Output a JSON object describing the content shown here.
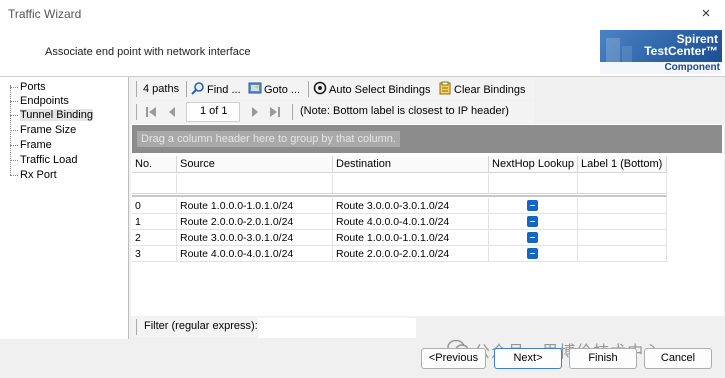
{
  "window": {
    "title": "Traffic Wizard",
    "close_glyph": "×"
  },
  "header": {
    "subtitle": "Associate end point with network interface",
    "logo": {
      "line1": "Spirent",
      "line2": "TestCenter™",
      "badge": "Component",
      "color": "#2c63a6"
    }
  },
  "nav": {
    "items": [
      {
        "label": "Ports"
      },
      {
        "label": "Endpoints"
      },
      {
        "label": "Tunnel Binding",
        "selected": true
      },
      {
        "label": "Frame Size"
      },
      {
        "label": "Frame"
      },
      {
        "label": "Traffic Load"
      },
      {
        "label": "Rx Port"
      }
    ]
  },
  "toolbar": {
    "paths_label": "4 paths",
    "find_label": "Find ...",
    "goto_label": "Goto ...",
    "auto_select_label": "Auto Select Bindings",
    "clear_label": "Clear Bindings"
  },
  "pager": {
    "page_text": "1 of 1",
    "note": "(Note: Bottom label is closest to IP header)"
  },
  "grid": {
    "group_hint": "Drag a column header here to group by that column.",
    "columns": [
      "No.",
      "Source",
      "Destination",
      "NextHop Lookup",
      "Label 1 (Bottom)"
    ],
    "rows": [
      {
        "no": "0",
        "source": "Route 1.0.0.0-1.0.1.0/24",
        "destination": "Route 3.0.0.0-3.0.1.0/24",
        "nexthop": true
      },
      {
        "no": "1",
        "source": "Route 2.0.0.0-2.0.1.0/24",
        "destination": "Route 4.0.0.0-4.0.1.0/24",
        "nexthop": true
      },
      {
        "no": "2",
        "source": "Route 3.0.0.0-3.0.1.0/24",
        "destination": "Route 1.0.0.0-1.0.1.0/24",
        "nexthop": true
      },
      {
        "no": "3",
        "source": "Route 4.0.0.0-4.0.1.0/24",
        "destination": "Route 2.0.0.0-2.0.1.0/24",
        "nexthop": true
      }
    ]
  },
  "filter": {
    "label": "Filter (regular express):",
    "value": ""
  },
  "buttons": {
    "previous": "<Previous",
    "next": "Next>",
    "finish": "Finish",
    "cancel": "Cancel"
  },
  "watermark": {
    "text": "公众号 · 思博伦技术中心"
  },
  "colors": {
    "checkbox": "#1466c8",
    "group_bar": "#8c8c8c",
    "accent_border": "#3f7ed0"
  }
}
